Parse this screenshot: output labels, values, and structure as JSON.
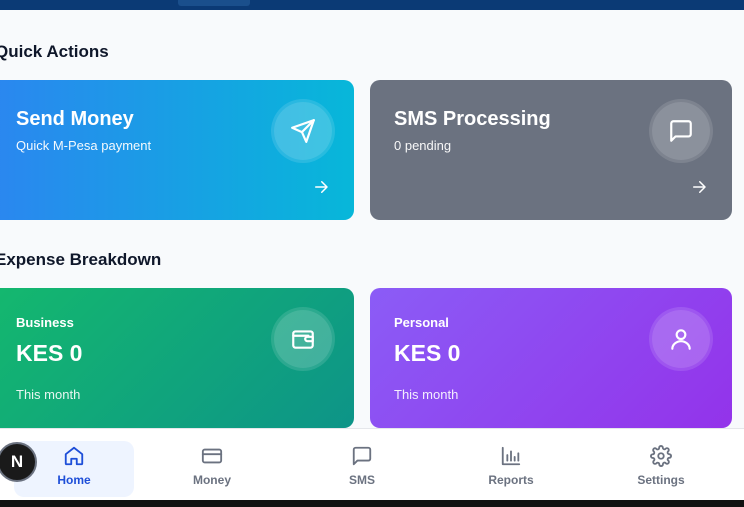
{
  "sections": {
    "quick_actions": "Quick Actions",
    "expense_breakdown": "Expense Breakdown"
  },
  "quick_actions": {
    "send_money": {
      "title": "Send Money",
      "subtitle": "Quick M-Pesa payment",
      "icon": "send-icon"
    },
    "sms_processing": {
      "title": "SMS Processing",
      "subtitle": "0 pending",
      "icon": "message-icon"
    }
  },
  "expenses": {
    "business": {
      "label": "Business",
      "amount": "KES 0",
      "period": "This month",
      "icon": "wallet-icon"
    },
    "personal": {
      "label": "Personal",
      "amount": "KES 0",
      "period": "This month",
      "icon": "user-icon"
    }
  },
  "bottom_nav": {
    "items": [
      {
        "label": "Home",
        "icon": "home-icon",
        "active": true
      },
      {
        "label": "Money",
        "icon": "card-icon",
        "active": false
      },
      {
        "label": "SMS",
        "icon": "message-icon",
        "active": false
      },
      {
        "label": "Reports",
        "icon": "bar-chart-icon",
        "active": false
      },
      {
        "label": "Settings",
        "icon": "gear-icon",
        "active": false
      }
    ]
  },
  "badge": {
    "letter": "N"
  },
  "colors": {
    "send_gradient": [
      "#2b86f0",
      "#07b7d9"
    ],
    "sms": "#6b7280",
    "business_gradient": [
      "#14b86e",
      "#0d9488"
    ],
    "personal_gradient": [
      "#8b5cf6",
      "#9333ea"
    ],
    "nav_active": "#1d4ed8"
  }
}
